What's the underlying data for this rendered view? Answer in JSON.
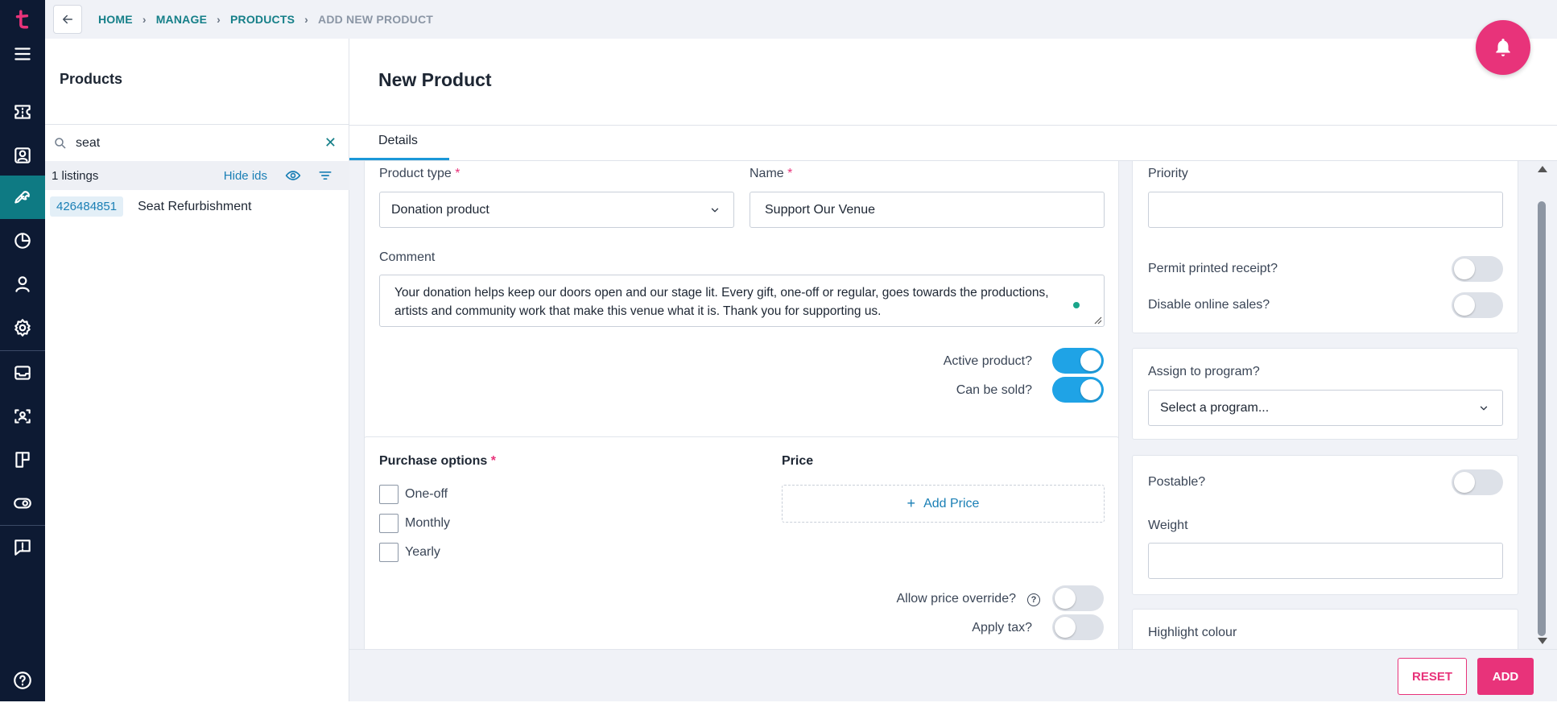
{
  "nav": {
    "icons": [
      "brand-logo-icon",
      "menu-icon",
      "tickets-icon",
      "contact-card-icon",
      "tools-icon",
      "reports-pie-icon",
      "person-icon",
      "settings-gear-icon",
      "inbox-icon",
      "face-scan-icon",
      "board-icon",
      "toggle-icon",
      "feedback-icon",
      "help-icon"
    ]
  },
  "breadcrumb": {
    "items": [
      "HOME",
      "MANAGE",
      "PRODUCTS",
      "ADD NEW PRODUCT"
    ]
  },
  "sidebar": {
    "title": "Products",
    "search_value": "seat",
    "listings_count": "1 listings",
    "hide_ids": "Hide ids",
    "results": [
      {
        "id": "426484851",
        "name": "Seat Refurbishment"
      }
    ]
  },
  "main": {
    "title": "New Product",
    "tabs": [
      "Details"
    ]
  },
  "form": {
    "product_type_label": "Product type",
    "product_type_value": "Donation product",
    "name_label": "Name",
    "name_value": "Support Our Venue",
    "comment_label": "Comment",
    "comment_value": "Your donation helps keep our doors open and our stage lit. Every gift, one-off or regular, goes towards the productions, artists and community work that make this venue what it is. Thank you for supporting us.",
    "active_label": "Active product?",
    "active_on": true,
    "can_be_sold_label": "Can be sold?",
    "can_be_sold_on": true,
    "purchase_options_label": "Purchase options",
    "purchase_options": [
      "One-off",
      "Monthly",
      "Yearly"
    ],
    "price_label": "Price",
    "add_price": "Add Price",
    "allow_override_label": "Allow price override?",
    "apply_tax_label": "Apply tax?",
    "required_mark": "*"
  },
  "right": {
    "priority_label": "Priority",
    "priority_value": "",
    "permit_receipt_label": "Permit printed receipt?",
    "disable_online_label": "Disable online sales?",
    "assign_program_label": "Assign to program?",
    "program_placeholder": "Select a program...",
    "postable_label": "Postable?",
    "weight_label": "Weight",
    "weight_value": "",
    "highlight_label": "Highlight colour"
  },
  "footer": {
    "reset": "RESET",
    "add": "ADD"
  },
  "colors": {
    "accent_pink": "#e8337a",
    "toggle_blue": "#1fa3e6",
    "nav_bg": "#0d1a33",
    "nav_active": "#0e7a83",
    "link_teal": "#157f88"
  }
}
